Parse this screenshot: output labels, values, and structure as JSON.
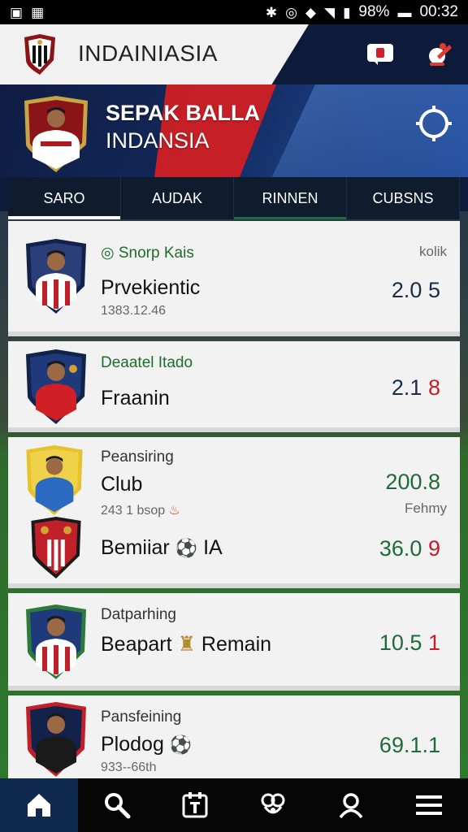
{
  "status_bar": {
    "left_icons": [
      "sim-icon",
      "image-icon"
    ],
    "battery": "98%",
    "time": "00:32"
  },
  "header": {
    "title": "INDAINIASIA"
  },
  "hero": {
    "title_line1": "SEPAK BALLA",
    "title_line2": "INDANSIA"
  },
  "tabs": [
    "SARO",
    "AUDAK",
    "RINNEN",
    "CUBSNS"
  ],
  "cards": [
    {
      "sub": "Snorp Kais",
      "name": "Prvekientic",
      "meta": "1383.12.46",
      "score_a": "2.0",
      "score_b": "5",
      "note": "kolik"
    },
    {
      "sub": "Deaatel Itado",
      "name": "Fraanin",
      "score_a": "2.1",
      "score_b": "8"
    },
    {
      "sub": "Peansiring",
      "name": "Club",
      "meta": "243 1 bsop",
      "score_a": "200.8",
      "note": "Fehmy",
      "name2": "Bemiiar",
      "name2_suffix": "IA",
      "score2_a": "36.0",
      "score2_b": "9"
    },
    {
      "sub": "Datparhing",
      "name": "Beapart",
      "name_suffix": "Remain",
      "score_a": "10.5",
      "score_b": "1"
    },
    {
      "sub": "Pansfeining",
      "name": "Plodog",
      "meta": "933--66th",
      "score_a": "69.1.1"
    }
  ],
  "nav": [
    "home-icon",
    "search-icon",
    "calendar-icon",
    "club-icon",
    "profile-icon",
    "menu-icon"
  ]
}
